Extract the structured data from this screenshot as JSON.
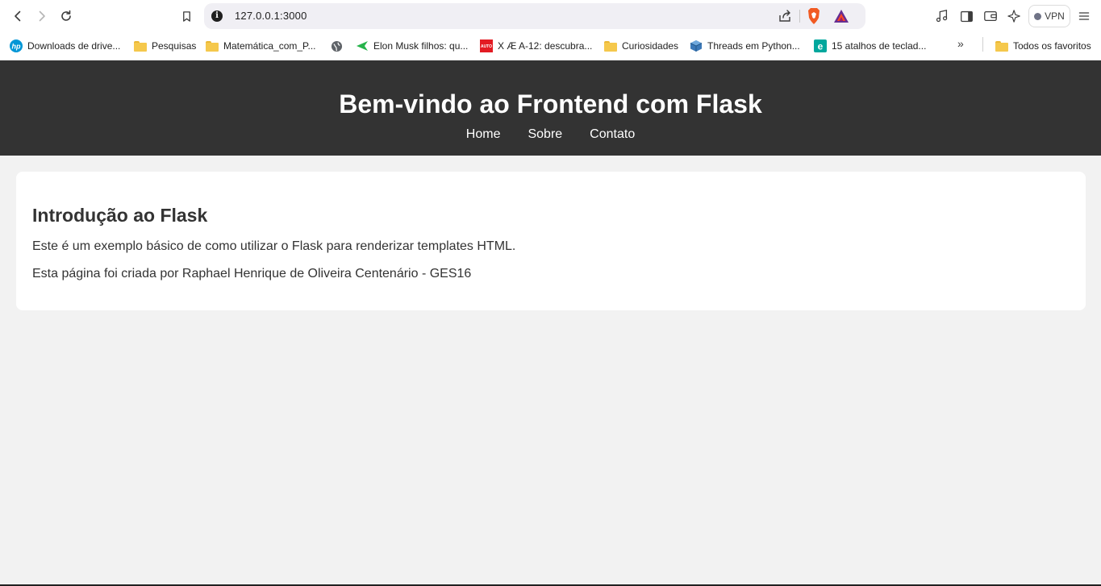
{
  "browser": {
    "url": "127.0.0.1:3000",
    "vpn_label": "VPN",
    "icons": [
      "back-icon",
      "forward-icon",
      "reload-icon",
      "bookmark-icon",
      "site-info-icon",
      "share-icon",
      "brave-shields-icon",
      "brave-rewards-icon",
      "media-icon",
      "sidebar-icon",
      "wallet-icon",
      "leo-ai-icon",
      "menu-icon"
    ]
  },
  "bookmarks": {
    "items": [
      {
        "label": "Downloads de drive...",
        "icon": "hp-icon"
      },
      {
        "label": "Pesquisas",
        "icon": "folder-icon"
      },
      {
        "label": "Matemática_com_P...",
        "icon": "folder-icon"
      },
      {
        "label": "",
        "icon": "globe-icon"
      },
      {
        "label": "Elon Musk filhos: qu...",
        "icon": "green-arrow-icon"
      },
      {
        "label": "X Æ A-12: descubra...",
        "icon": "auto-icon"
      },
      {
        "label": "Curiosidades",
        "icon": "folder-icon"
      },
      {
        "label": "Threads em Python...",
        "icon": "cube-icon"
      },
      {
        "label": "15 atalhos de teclad...",
        "icon": "e-icon"
      }
    ],
    "more": "»",
    "all_label": "Todos os favoritos"
  },
  "page": {
    "title": "Bem-vindo ao Frontend com Flask",
    "nav": [
      "Home",
      "Sobre",
      "Contato"
    ],
    "section": {
      "heading": "Introdução ao Flask",
      "paragraphs": [
        "Este é um exemplo básico de como utilizar o Flask para renderizar templates HTML.",
        "Esta página foi criada por Raphael Henrique de Oliveira Centenário - GES16"
      ]
    }
  }
}
